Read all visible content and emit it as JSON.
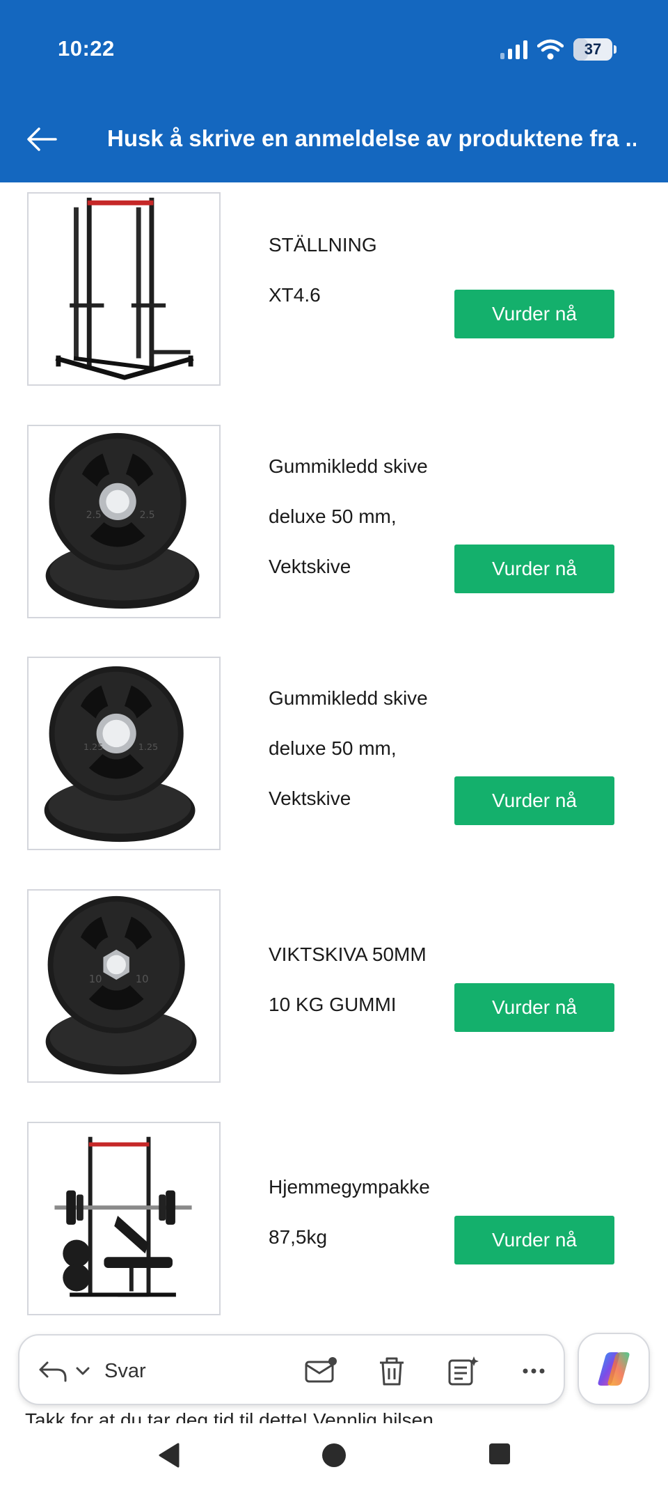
{
  "status_bar": {
    "time": "10:22",
    "battery": "37"
  },
  "header": {
    "title": "Husk å skrive en anmeldelse av produktene fra ..."
  },
  "products": [
    {
      "lines": [
        "STÄLLNING",
        "XT4.6"
      ],
      "button": "Vurder nå",
      "image": "squat-rack"
    },
    {
      "lines": [
        "Gummikledd skive",
        "deluxe 50 mm,",
        "Vektskive"
      ],
      "button": "Vurder nå",
      "image": "weight-plate-2.5"
    },
    {
      "lines": [
        "Gummikledd skive",
        "deluxe 50 mm,",
        "Vektskive"
      ],
      "button": "Vurder nå",
      "image": "weight-plate-1.25"
    },
    {
      "lines": [
        "VIKTSKIVA 50MM",
        "10 KG GUMMI"
      ],
      "button": "Vurder nå",
      "image": "weight-plate-10"
    },
    {
      "lines": [
        "Hjemmegympakke",
        "87,5kg"
      ],
      "button": "Vurder nå",
      "image": "home-gym-package"
    }
  ],
  "plate_labels": [
    "2.5",
    "1.25",
    "10"
  ],
  "toolbar": {
    "reply_label": "Svar"
  },
  "footer": {
    "text": "Takk for at du tar deg tid til dette! Vennlig hilsen"
  },
  "colors": {
    "header": "#1467bf",
    "button": "#14b06c"
  }
}
